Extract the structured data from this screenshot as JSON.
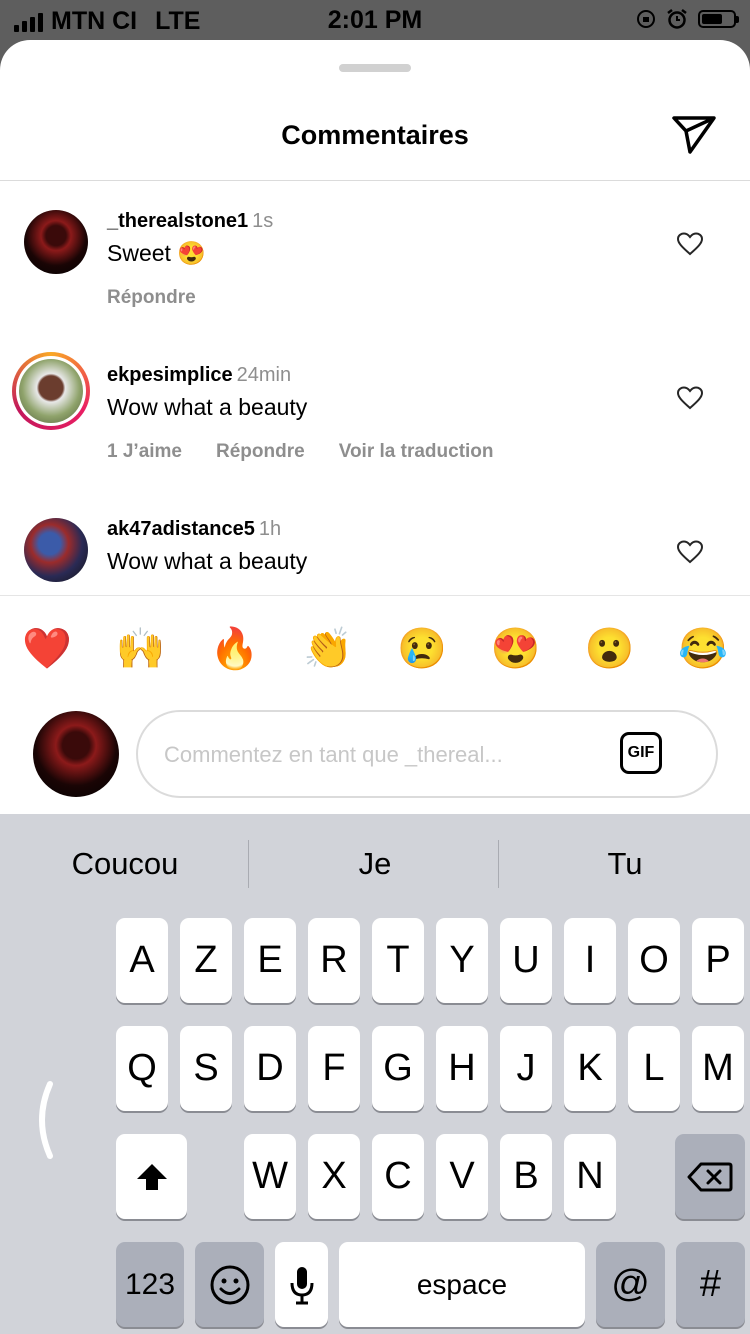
{
  "status": {
    "carrier": "MTN CI",
    "network": "LTE",
    "time": "2:01 PM"
  },
  "header": {
    "title": "Commentaires"
  },
  "comments": [
    {
      "username": "_therealstone1",
      "time": "1s",
      "text": "Sweet",
      "emoji": "😍",
      "actions": [
        "Répondre"
      ]
    },
    {
      "username": "ekpesimplice",
      "time": "24min",
      "text": "Wow what a beauty",
      "emoji": "",
      "actions": [
        "1 J’aime",
        "Répondre",
        "Voir la traduction"
      ]
    },
    {
      "username": "ak47adistance5",
      "time": "1h",
      "text": "Wow what a beauty",
      "emoji": "",
      "actions": []
    }
  ],
  "quick_emojis": [
    "❤️",
    "🙌",
    "🔥",
    "👏",
    "😢",
    "😍",
    "😮",
    "😂"
  ],
  "composer": {
    "placeholder": "Commentez en tant que _thereal...",
    "gif_label": "GIF"
  },
  "keyboard": {
    "suggestions": [
      "Coucou",
      "Je",
      "Tu"
    ],
    "row1": [
      "A",
      "Z",
      "E",
      "R",
      "T",
      "Y",
      "U",
      "I",
      "O",
      "P"
    ],
    "row2": [
      "Q",
      "S",
      "D",
      "F",
      "G",
      "H",
      "J",
      "K",
      "L",
      "M"
    ],
    "row3": [
      "W",
      "X",
      "C",
      "V",
      "B",
      "N"
    ],
    "numbers_label": "123",
    "space_label": "espace",
    "at_label": "@",
    "hash_label": "#"
  }
}
